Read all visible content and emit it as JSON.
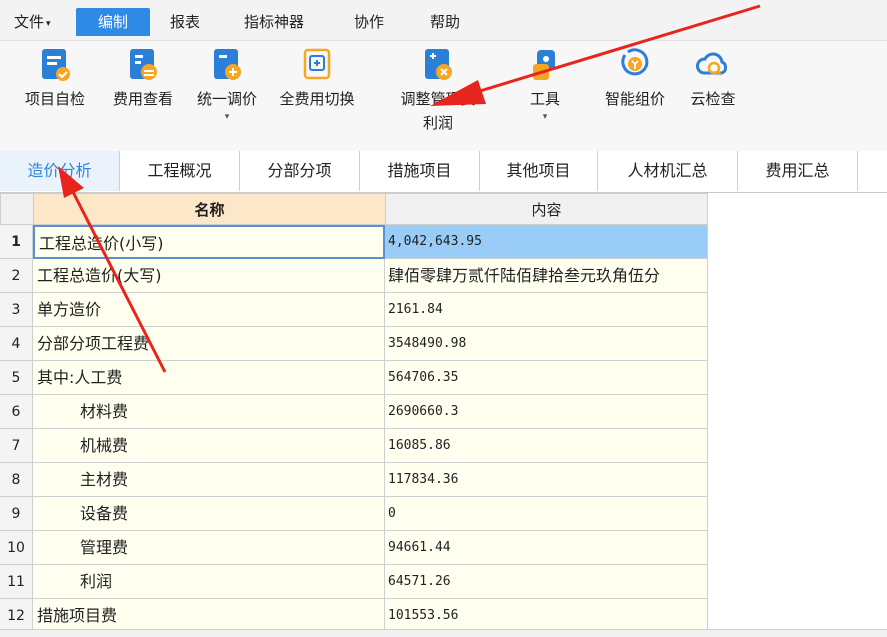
{
  "menu": {
    "items": [
      {
        "label": "文件",
        "caret": "▾"
      },
      {
        "label": "编制"
      },
      {
        "label": "报表"
      },
      {
        "label": "指标神器"
      },
      {
        "label": "协作"
      },
      {
        "label": "帮助"
      }
    ],
    "active": "编制"
  },
  "ribbon": {
    "buttons": [
      {
        "label": "项目自检",
        "icon": "project-check-icon"
      },
      {
        "label": "费用查看",
        "icon": "fee-view-icon"
      },
      {
        "label": "统一调价",
        "icon": "unified-price-icon",
        "dropdown": "▾"
      },
      {
        "label": "全费用切换",
        "icon": "full-fee-switch-icon"
      },
      {
        "label": "调整管理费",
        "label2": "利润",
        "icon": "adjust-fee-icon"
      },
      {
        "label": "工具",
        "icon": "tools-icon",
        "dropdown": "▾"
      },
      {
        "label": "智能组价",
        "icon": "smart-price-icon"
      },
      {
        "label": "云检查",
        "icon": "cloud-check-icon"
      }
    ]
  },
  "tabs": [
    "造价分析",
    "工程概况",
    "分部分项",
    "措施项目",
    "其他项目",
    "人材机汇总",
    "费用汇总"
  ],
  "active_tab": "造价分析",
  "table": {
    "headers": [
      "名称",
      "内容"
    ],
    "rows": [
      {
        "no": "1",
        "name": "工程总造价(小写)",
        "value": "4,042,643.95"
      },
      {
        "no": "2",
        "name": "工程总造价(大写)",
        "value": "肆佰零肆万贰仟陆佰肆拾叁元玖角伍分"
      },
      {
        "no": "3",
        "name": "单方造价",
        "value": "2161.84"
      },
      {
        "no": "4",
        "name": "分部分项工程费",
        "value": "3548490.98"
      },
      {
        "no": "5",
        "name": "其中:人工费",
        "value": "564706.35"
      },
      {
        "no": "6",
        "name": "材料费",
        "value": "2690660.3"
      },
      {
        "no": "7",
        "name": "机械费",
        "value": "16085.86"
      },
      {
        "no": "8",
        "name": "主材费",
        "value": "117834.36"
      },
      {
        "no": "9",
        "name": "设备费",
        "value": "0"
      },
      {
        "no": "10",
        "name": "管理费",
        "value": "94661.44"
      },
      {
        "no": "11",
        "name": "利润",
        "value": "64571.26"
      },
      {
        "no": "12",
        "name": "措施项目费",
        "value": "101553.56"
      }
    ]
  },
  "colors": {
    "accent": "#2f8ae5",
    "selected_row": "#99cdf7",
    "cell_bg": "#fffff0",
    "header_bg": "#fce7c8",
    "arrow": "#e8251c"
  }
}
